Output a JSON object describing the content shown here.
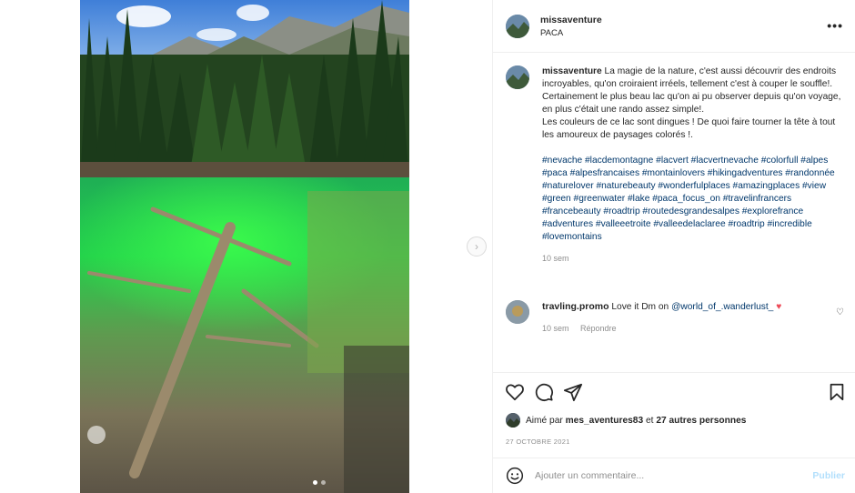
{
  "post": {
    "username": "missaventure",
    "location": "PACA"
  },
  "caption": {
    "username": "missaventure",
    "lines": [
      "La magie de la nature, c'est aussi découvrir des endroits incroyables, qu'on croiraient irréels, tellement c'est à couper le souffle!.",
      "Certainement le plus beau lac qu'on ai pu observer depuis qu'on voyage, en plus c'était une rando assez simple!.",
      "Les couleurs de ce lac sont dingues ! De quoi faire tourner la tête à tout les amoureux de paysages colorés !."
    ],
    "hashtags": "#nevache #lacdemontagne #lacvert #lacvertnevache #colorfull #alpes #paca #alpesfrancaises #montainlovers #hikingadventures #randonnée #naturelover #naturebeauty #wonderfulplaces #amazingplaces #view #green #greenwater #lake #paca_focus_on #travelinfrancers #francebeauty #roadtrip #routedesgrandesalpes #explorefrance #adventures #valleeetroite #valleedelaclaree #roadtrip #incredible #lovemontains",
    "time": "10 sem"
  },
  "comment": {
    "username": "travling.promo",
    "text": "Love it Dm on",
    "mention": "@world_of_.wanderlust_",
    "emoji": "♥",
    "time": "10 sem",
    "reply_label": "Répondre"
  },
  "likes": {
    "prefix": "Aimé par",
    "user": "mes_aventures83",
    "middle": "et",
    "others": "27 autres personnes"
  },
  "date": "27 OCTOBRE 2021",
  "composer": {
    "placeholder": "Ajouter un commentaire...",
    "publish_label": "Publier"
  },
  "icons": {
    "more": "more-icon",
    "like": "heart-icon",
    "comment": "comment-icon",
    "share": "share-icon",
    "save": "bookmark-icon",
    "next": "chevron-right-icon",
    "emoji": "smiley-icon"
  },
  "colors": {
    "link": "#00376b",
    "muted": "#8e8e8e",
    "publish_disabled": "#b2dffc",
    "heart": "#ed4956"
  }
}
